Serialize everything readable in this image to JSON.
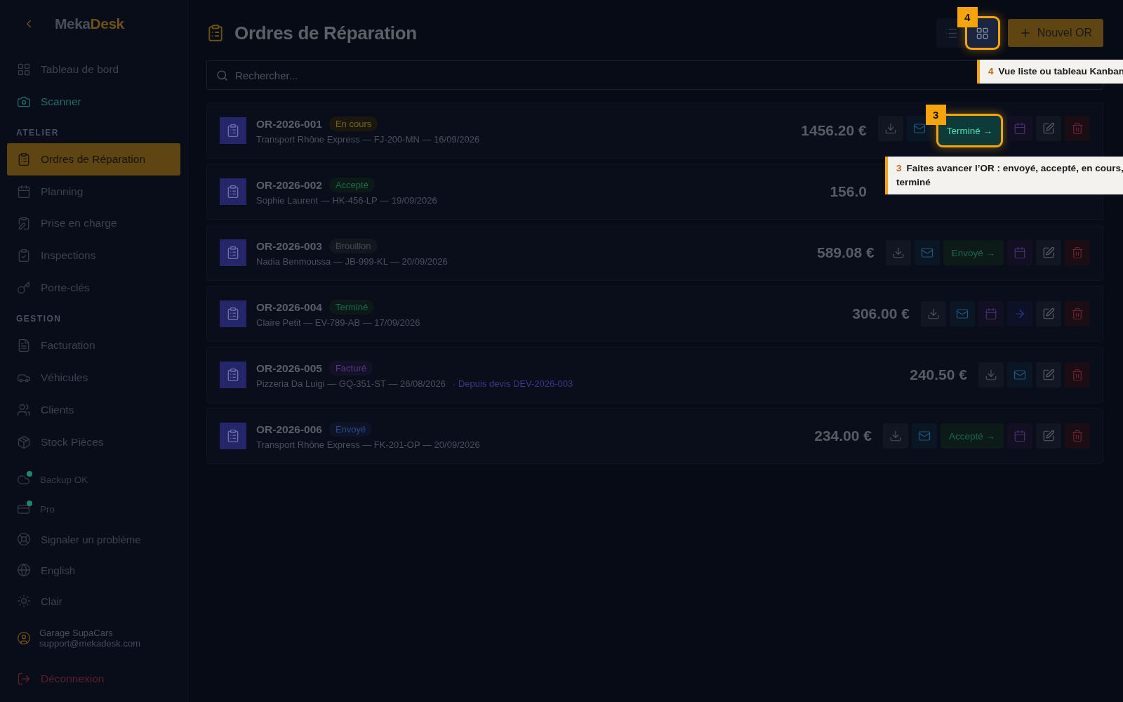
{
  "sidebar": {
    "logo": {
      "part_1": "Meka",
      "part_2": "Desk"
    },
    "groups": [
      {
        "items": [
          {
            "label": "Tableau de bord",
            "selected": false
          },
          {
            "label": "Scanner",
            "selected": false,
            "color": "#1f6e66"
          }
        ]
      },
      {
        "heading": "ATELIER",
        "items": [
          {
            "label": "Ordres de Réparation",
            "selected": true
          },
          {
            "label": "Planning",
            "selected": false
          },
          {
            "label": "Prise en charge",
            "selected": false
          },
          {
            "label": "Inspections",
            "selected": false
          },
          {
            "label": "Porte-clés",
            "selected": false
          }
        ]
      },
      {
        "heading": "GESTION",
        "items": [
          {
            "label": "Facturation",
            "selected": false
          },
          {
            "label": "Véhicules",
            "selected": false
          },
          {
            "label": "Clients",
            "selected": false
          },
          {
            "label": "Stock Pièces",
            "selected": false
          }
        ]
      }
    ],
    "status_items": [
      {
        "label": "Backup OK",
        "color": "#1d8a6a"
      },
      {
        "label": "Pro",
        "color": "#1d8a6a"
      }
    ],
    "utility_items": [
      {
        "label": "Signaler un problème"
      },
      {
        "label": "English"
      },
      {
        "label": "Clair"
      }
    ],
    "account": {
      "name": "Garage SupaCars",
      "email": "support@mekadesk.com"
    },
    "logout": "Déconnexion"
  },
  "header": {
    "title": "Ordres de Réparation",
    "view_toggle": [
      {
        "kind": "list",
        "selected": false
      },
      {
        "kind": "grid",
        "selected": true,
        "step": "4"
      }
    ],
    "new_button": "Nouvel OR"
  },
  "search": {
    "placeholder": "Rechercher..."
  },
  "orders": [
    {
      "number": "OR-2026-001",
      "status": "En cours",
      "kind": "progress",
      "details": "Transport Rhône Express — FJ-200-MN — 16/09/2026",
      "amount": "1456.20 €",
      "actions": [
        {
          "kind": "download"
        },
        {
          "kind": "mail"
        },
        {
          "kind": "advance",
          "label": "Terminé →",
          "step": "3"
        },
        {
          "kind": "calendar"
        },
        {
          "kind": "edit"
        },
        {
          "kind": "delete"
        }
      ]
    },
    {
      "number": "OR-2026-002",
      "status": "Accepté",
      "kind": "accepted",
      "details": "Sophie Laurent — HK-456-LP — 19/09/2026",
      "amount": "156.0"
    },
    {
      "number": "OR-2026-003",
      "status": "Brouillon",
      "kind": "draft",
      "details": "Nadia Benmoussa — JB-999-KL — 20/09/2026",
      "amount": "589.08 €",
      "actions": [
        {
          "kind": "download"
        },
        {
          "kind": "mail"
        },
        {
          "kind": "advance",
          "label": "Envoyé →"
        },
        {
          "kind": "calendar"
        },
        {
          "kind": "edit"
        },
        {
          "kind": "delete"
        }
      ]
    },
    {
      "number": "OR-2026-004",
      "status": "Terminé",
      "kind": "accepted",
      "details": "Claire Petit — EV-789-AB — 17/09/2026",
      "amount": "306.00 €",
      "actions": [
        {
          "kind": "download"
        },
        {
          "kind": "mail"
        },
        {
          "kind": "calendar"
        },
        {
          "kind": "arrow"
        },
        {
          "kind": "edit"
        },
        {
          "kind": "delete"
        }
      ]
    },
    {
      "number": "OR-2026-005",
      "status": "Facturé",
      "kind": "invoiced",
      "details": "Pizzeria Da Luigi — GQ-351-ST — 26/08/2026",
      "link": "· Depuis devis DEV-2026-003",
      "amount": "240.50 €",
      "actions": [
        {
          "kind": "download"
        },
        {
          "kind": "mail"
        },
        {
          "kind": "edit"
        },
        {
          "kind": "delete"
        }
      ]
    },
    {
      "number": "OR-2026-006",
      "status": "Envoyé",
      "kind": "sent",
      "details": "Transport Rhône Express — FK-201-OP — 20/09/2026",
      "amount": "234.00 €",
      "actions": [
        {
          "kind": "download"
        },
        {
          "kind": "mail"
        },
        {
          "kind": "advance",
          "label": "Accepté →"
        },
        {
          "kind": "calendar"
        },
        {
          "kind": "edit"
        },
        {
          "kind": "delete"
        }
      ]
    }
  ],
  "callouts": [
    {
      "step": "4",
      "text": "Vue liste ou tableau Kanban"
    },
    {
      "step": "3",
      "text": "Faites avancer l’OR : envoyé, accepté, en cours, terminé"
    }
  ]
}
